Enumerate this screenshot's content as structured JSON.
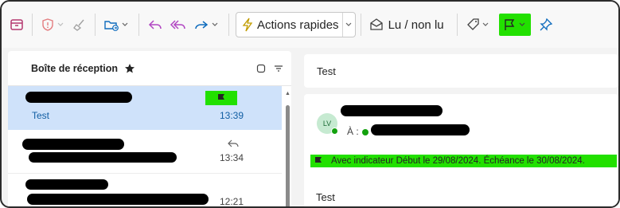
{
  "toolbar": {
    "quick_actions_label": "Actions rapides",
    "read_unread_label": "Lu / non lu",
    "highlight_color": "#22e000",
    "icons": [
      "archive-icon",
      "report-icon",
      "sweep-icon",
      "move-to-folder-icon",
      "reply-icon",
      "reply-all-icon",
      "forward-icon",
      "lightning-icon",
      "envelope-open-icon",
      "tag-icon",
      "flag-icon",
      "pin-icon"
    ]
  },
  "message_list": {
    "folder_title": "Boîte de réception",
    "messages": [
      {
        "subject": "Test",
        "time": "13:39",
        "flagged": true,
        "selected": true
      },
      {
        "subject": "",
        "time": "13:34",
        "replied": true
      },
      {
        "subject": "",
        "time": "12:21"
      }
    ]
  },
  "reading_pane": {
    "subject": "Test",
    "avatar_initials": "LV",
    "to_label": "À :",
    "flag_text": "Avec indicateur Début le 29/08/2024. Échéance le 30/08/2024.",
    "body": "Test"
  },
  "colors": {
    "accent": "#115ea3",
    "selected_row": "#cfe2fa",
    "redaction": "#000000"
  }
}
